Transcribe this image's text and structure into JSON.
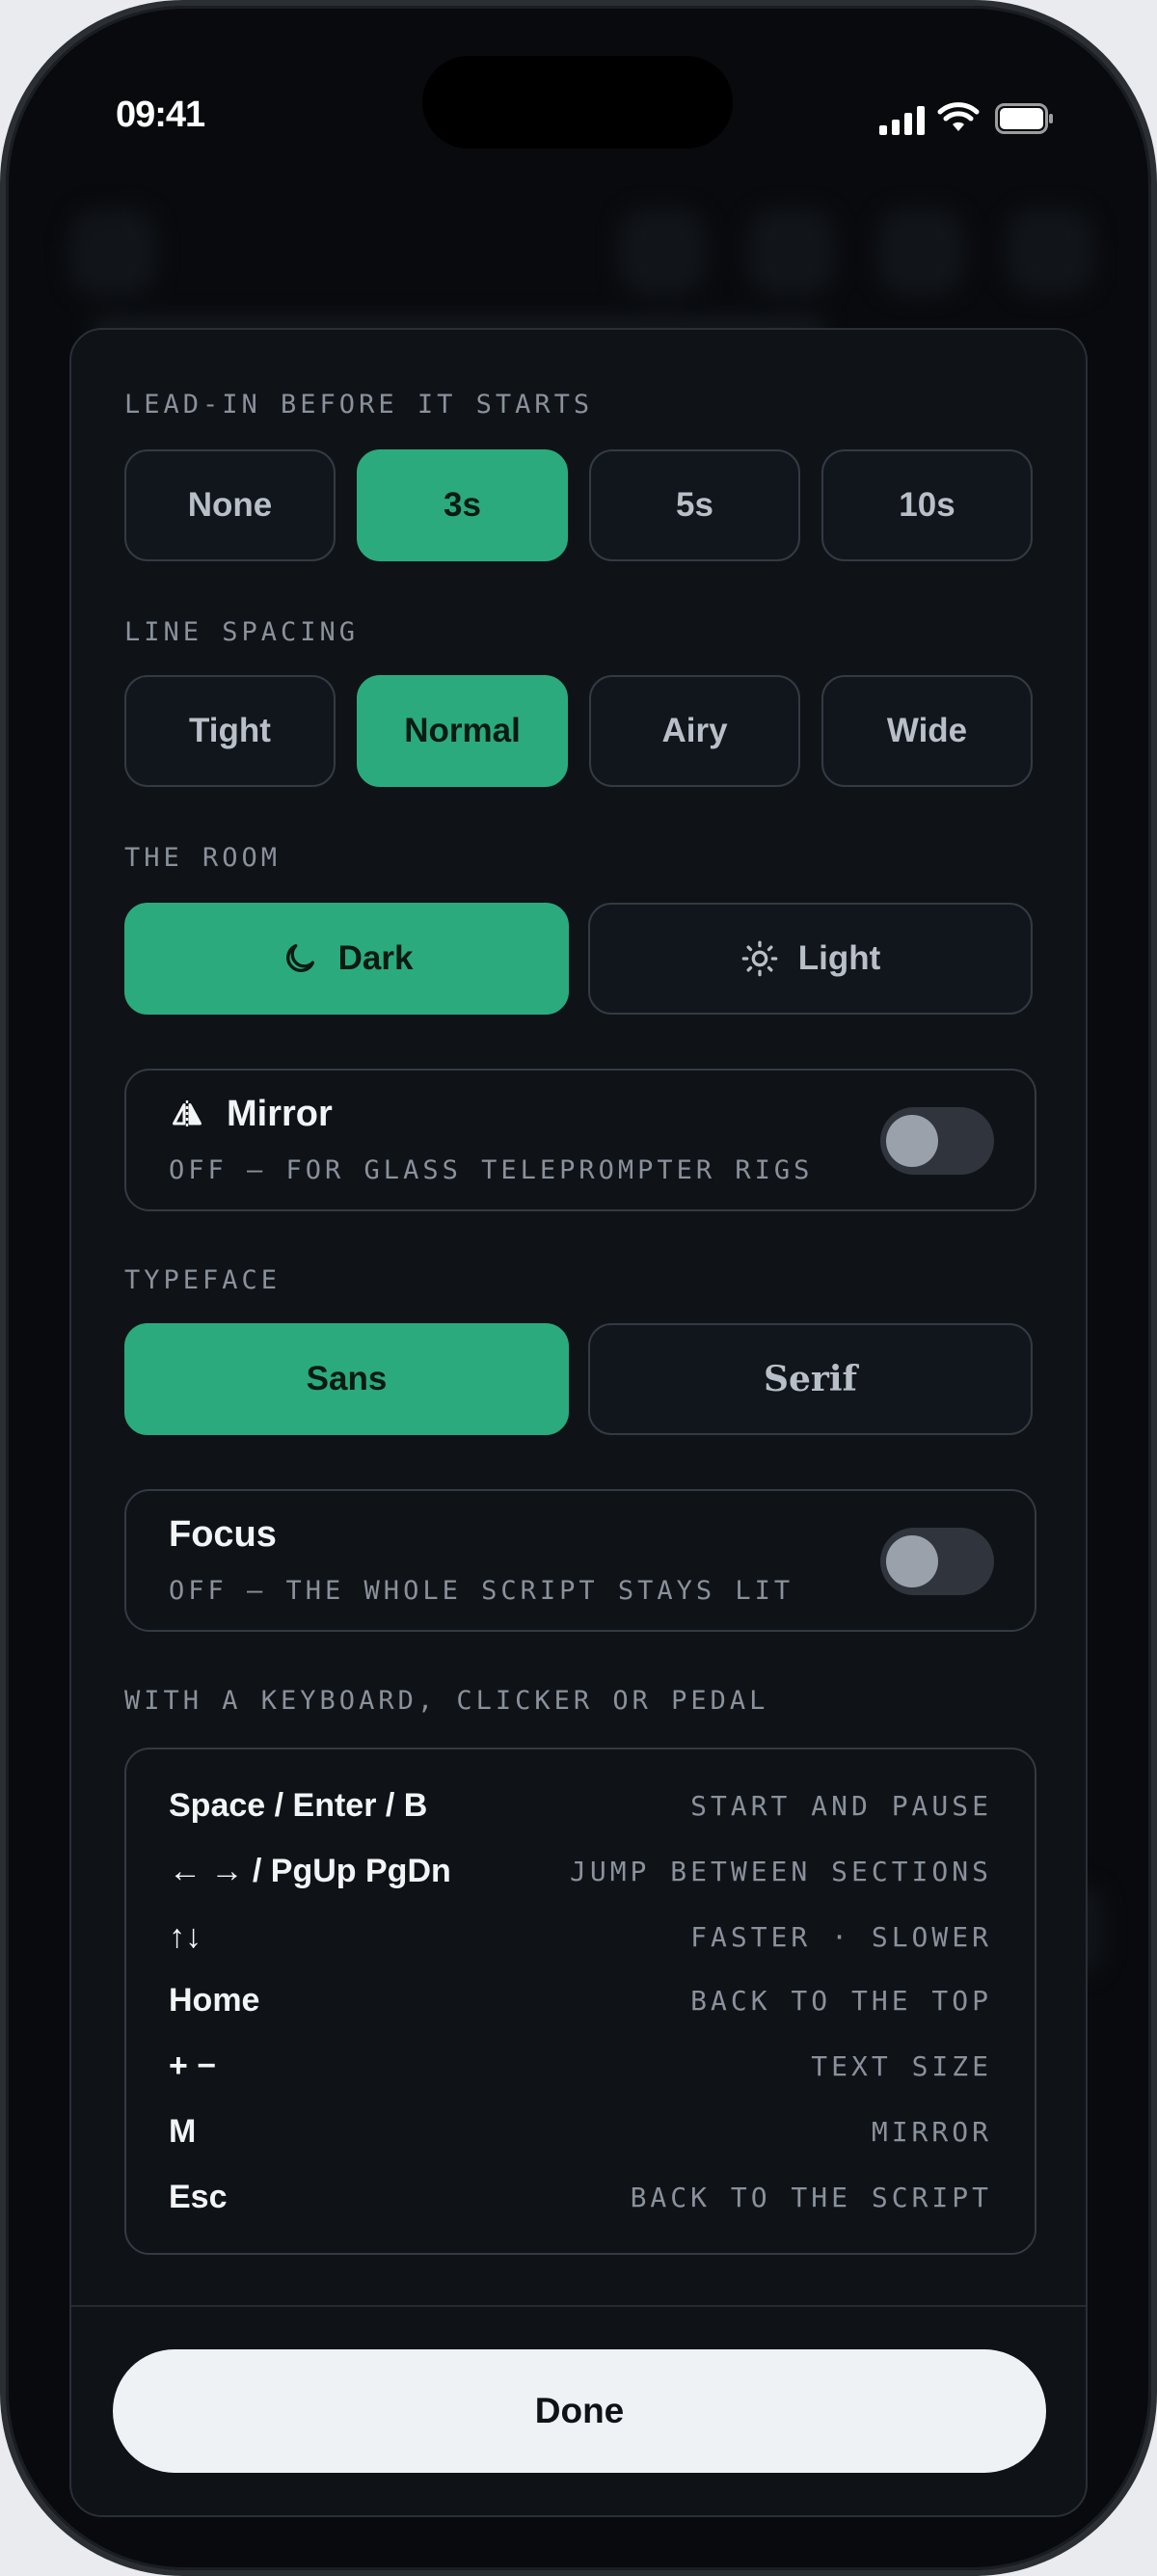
{
  "status_bar": {
    "time": "09:41"
  },
  "lead_in": {
    "label": "LEAD-IN BEFORE IT STARTS",
    "options": [
      "None",
      "3s",
      "5s",
      "10s"
    ],
    "selected": "3s"
  },
  "line_spacing": {
    "label": "LINE SPACING",
    "options": [
      "Tight",
      "Normal",
      "Airy",
      "Wide"
    ],
    "selected": "Normal"
  },
  "room": {
    "label": "THE ROOM",
    "options": [
      {
        "label": "Dark",
        "icon": "moon-icon"
      },
      {
        "label": "Light",
        "icon": "sun-icon"
      }
    ],
    "selected": "Dark"
  },
  "mirror": {
    "title": "Mirror",
    "icon": "mirror-icon",
    "subtitle": "OFF — FOR GLASS TELEPROMPTER RIGS",
    "on": false
  },
  "typeface": {
    "label": "TYPEFACE",
    "options": [
      "Sans",
      "Serif"
    ],
    "selected": "Sans"
  },
  "focus": {
    "title": "Focus",
    "subtitle": "OFF — THE WHOLE SCRIPT STAYS LIT",
    "on": false
  },
  "shortcuts": {
    "label": "WITH A KEYBOARD, CLICKER OR PEDAL",
    "items": [
      {
        "key": "Space / Enter / B",
        "action": "START AND PAUSE"
      },
      {
        "key": "← → / PgUp PgDn",
        "action": "JUMP BETWEEN SECTIONS"
      },
      {
        "key": "↑↓",
        "action": "FASTER · SLOWER"
      },
      {
        "key": "Home",
        "action": "BACK TO THE TOP"
      },
      {
        "key": "+ −",
        "action": "TEXT SIZE"
      },
      {
        "key": "M",
        "action": "MIRROR"
      },
      {
        "key": "Esc",
        "action": "BACK TO THE SCRIPT"
      }
    ]
  },
  "done_label": "Done",
  "colors": {
    "accent": "#2bab7d",
    "sheet": "#0f1318",
    "border": "#343a43",
    "muted_text": "#8a919b"
  }
}
